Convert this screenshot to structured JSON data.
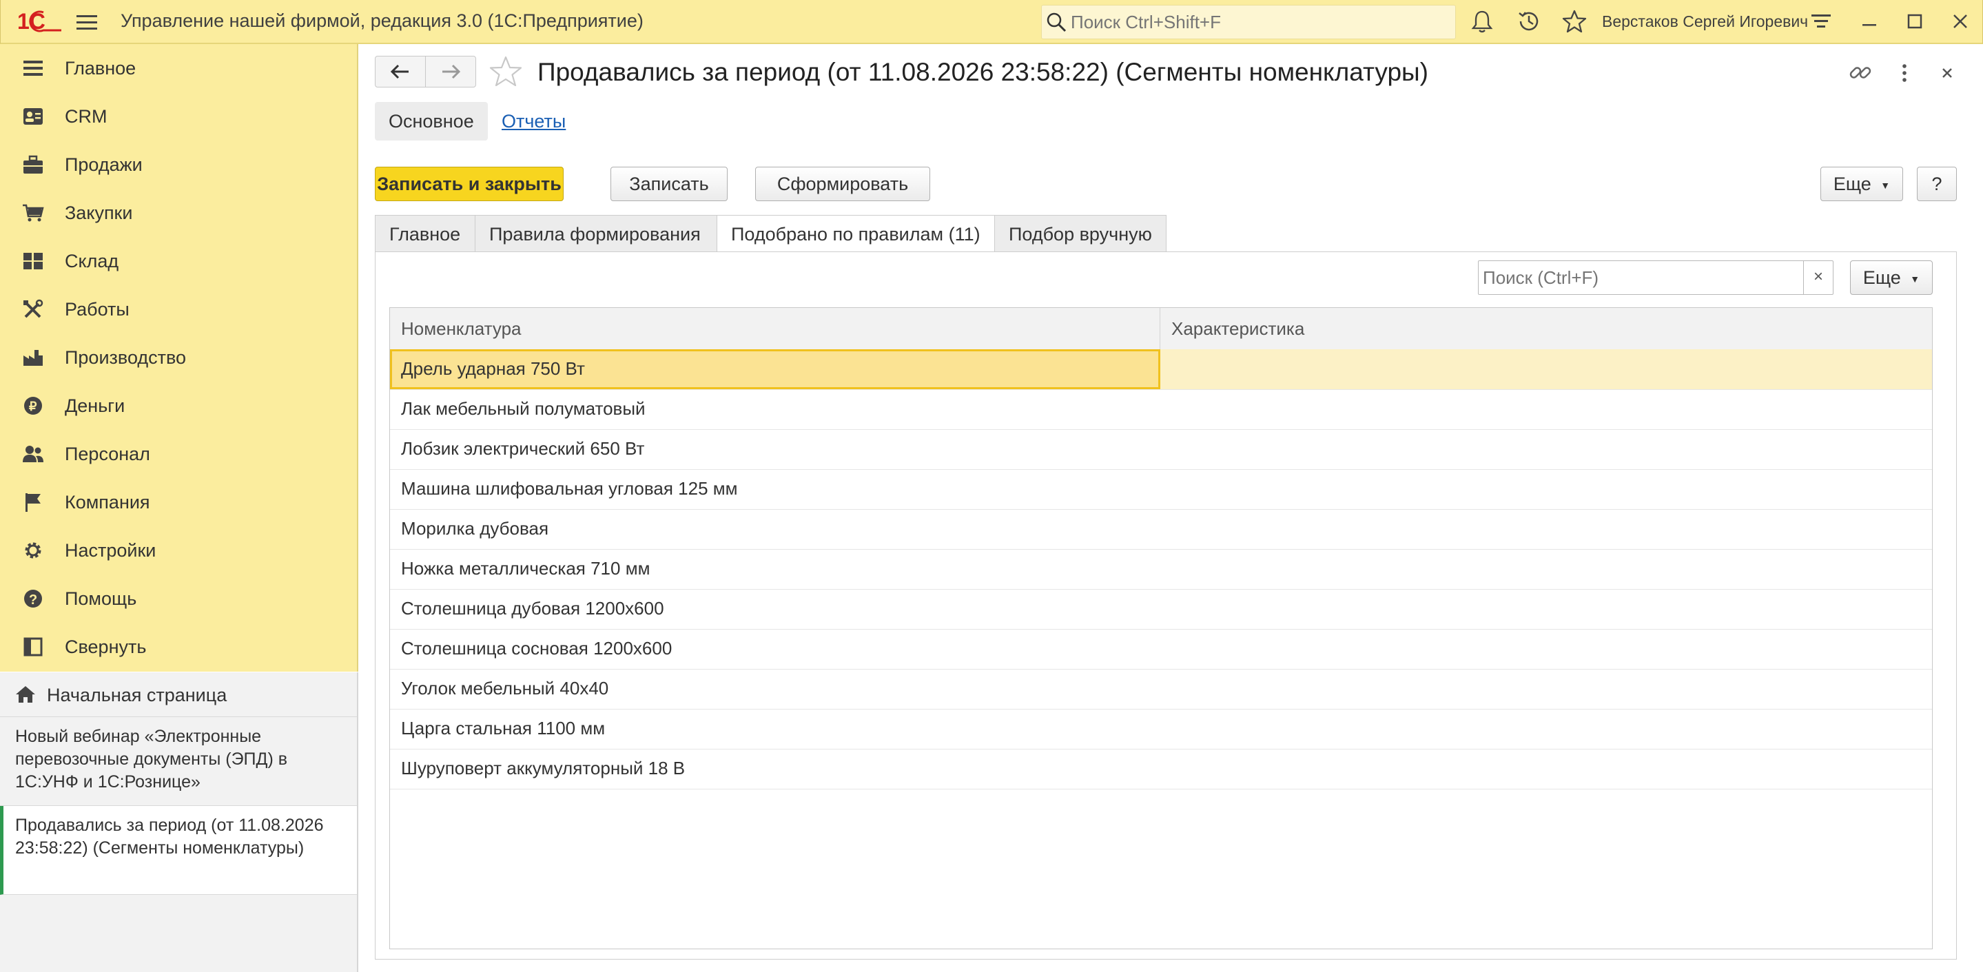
{
  "header": {
    "app_title": "Управление нашей фирмой, редакция 3.0  (1С:Предприятие)",
    "search_placeholder": "Поиск Ctrl+Shift+F",
    "user_name": "Верстаков Сергей Игоревич",
    "logo_text": "1С"
  },
  "sidebar": {
    "items": [
      {
        "label": "Главное",
        "icon": "menu-lines-icon"
      },
      {
        "label": "CRM",
        "icon": "contact-card-icon"
      },
      {
        "label": "Продажи",
        "icon": "briefcase-icon"
      },
      {
        "label": "Закупки",
        "icon": "cart-icon"
      },
      {
        "label": "Склад",
        "icon": "warehouse-grid-icon"
      },
      {
        "label": "Работы",
        "icon": "tools-icon"
      },
      {
        "label": "Производство",
        "icon": "factory-icon"
      },
      {
        "label": "Деньги",
        "icon": "ruble-coin-icon"
      },
      {
        "label": "Персонал",
        "icon": "people-icon"
      },
      {
        "label": "Компания",
        "icon": "flag-icon"
      },
      {
        "label": "Настройки",
        "icon": "gear-icon"
      },
      {
        "label": "Помощь",
        "icon": "help-circle-icon"
      },
      {
        "label": "Свернуть",
        "icon": "collapse-panel-icon"
      }
    ]
  },
  "open_windows": {
    "home_label": "Начальная страница",
    "items": [
      {
        "title": "Новый вебинар «Электронные перевозочные документы (ЭПД) в 1С:УНФ и 1С:Рознице»"
      },
      {
        "title": "Продавались за период (от 11.08.2026 23:58:22) (Сегменты номенклатуры)"
      }
    ]
  },
  "form": {
    "title": "Продавались за период (от 11.08.2026 23:58:22) (Сегменты номенклатуры)",
    "section_tabs": {
      "main": "Основное",
      "reports": "Отчеты"
    },
    "buttons": {
      "save_close": "Записать и закрыть",
      "save": "Записать",
      "build": "Сформировать",
      "more": "Еще",
      "help": "?"
    },
    "tabs": [
      {
        "label": "Главное"
      },
      {
        "label": "Правила формирования"
      },
      {
        "label": "Подобрано по правилам (11)"
      },
      {
        "label": "Подбор вручную"
      }
    ],
    "active_tab": 2
  },
  "list": {
    "search_placeholder": "Поиск (Ctrl+F)",
    "clear_label": "×",
    "more_label": "Еще",
    "columns": [
      "Номенклатура",
      "Характеристика"
    ],
    "selected_row": 0,
    "rows": [
      {
        "nom": "Дрель ударная 750 Вт",
        "char": ""
      },
      {
        "nom": "Лак мебельный полуматовый",
        "char": ""
      },
      {
        "nom": "Лобзик электрический 650 Вт",
        "char": ""
      },
      {
        "nom": "Машина шлифовальная угловая 125 мм",
        "char": ""
      },
      {
        "nom": "Морилка дубовая",
        "char": ""
      },
      {
        "nom": "Ножка металлическая 710 мм",
        "char": ""
      },
      {
        "nom": "Столешница дубовая 1200х600",
        "char": ""
      },
      {
        "nom": "Столешница сосновая 1200х600",
        "char": ""
      },
      {
        "nom": "Уголок мебельный 40х40",
        "char": ""
      },
      {
        "nom": "Царга стальная 1100 мм",
        "char": ""
      },
      {
        "nom": "Шуруповерт аккумуляторный 18 В",
        "char": ""
      }
    ]
  },
  "colors": {
    "accent_yellow": "#fbed9e",
    "primary_button": "#f7d51f",
    "selected_row": "#fcf1c6",
    "active_window_marker": "#2e9a50",
    "link": "#1a5fb4",
    "logo_red": "#d4201f"
  }
}
